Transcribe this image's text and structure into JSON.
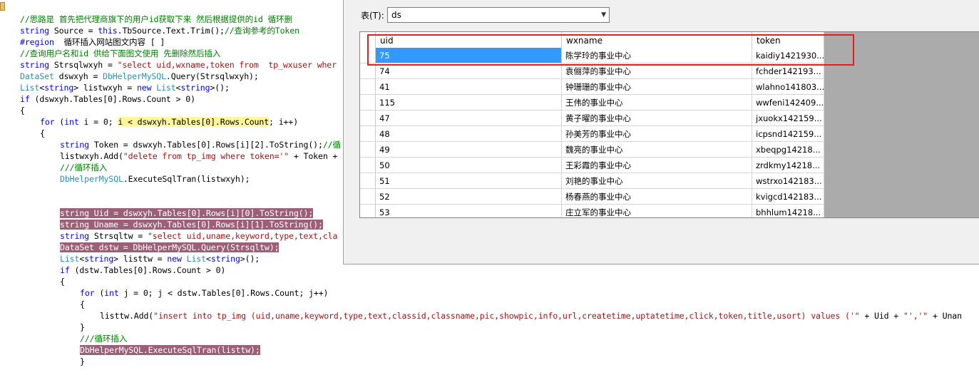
{
  "editor": {
    "lines": [
      {
        "indent": 2,
        "parts": [
          {
            "t": "//思路是 首先把代理商旗下的用户id获取下来 然后根据提供的id 循环删",
            "c": "cmt"
          }
        ]
      },
      {
        "indent": 2,
        "parts": [
          {
            "t": "string",
            "c": "kw"
          },
          {
            "t": " Source = "
          },
          {
            "t": "this",
            "c": "kw"
          },
          {
            "t": ".TbSource.Text.Trim();"
          },
          {
            "t": "//查询参考的Token",
            "c": "cmt"
          }
        ]
      },
      {
        "indent": 2,
        "parts": [
          {
            "t": "#region",
            "c": "kw"
          },
          {
            "t": "  循环插入网站图文内容 [ ]"
          }
        ]
      },
      {
        "indent": 2,
        "parts": [
          {
            "t": "//查询用户名和id 供给下面图文使用 先删除然后插入",
            "c": "cmt"
          }
        ]
      },
      {
        "indent": 2,
        "parts": [
          {
            "t": "string",
            "c": "kw"
          },
          {
            "t": " Strsqlwxyh = "
          },
          {
            "t": "\"select uid,wxname,token from  tp_wxuser wher",
            "c": "str"
          }
        ]
      },
      {
        "indent": 2,
        "parts": [
          {
            "t": "DataSet",
            "c": "ty"
          },
          {
            "t": " dswxyh = "
          },
          {
            "t": "DbHelperMySQL",
            "c": "ty"
          },
          {
            "t": ".Query(Strsqlwxyh);"
          }
        ]
      },
      {
        "indent": 2,
        "parts": [
          {
            "t": "List",
            "c": "ty"
          },
          {
            "t": "<"
          },
          {
            "t": "string",
            "c": "kw"
          },
          {
            "t": "> listwxyh = "
          },
          {
            "t": "new",
            "c": "kw"
          },
          {
            "t": " "
          },
          {
            "t": "List",
            "c": "ty"
          },
          {
            "t": "<"
          },
          {
            "t": "string",
            "c": "kw"
          },
          {
            "t": ">();"
          }
        ]
      },
      {
        "indent": 2,
        "parts": [
          {
            "t": "if",
            "c": "kw"
          },
          {
            "t": " (dswxyh.Tables[0].Rows.Count > 0)"
          }
        ]
      },
      {
        "indent": 2,
        "parts": [
          {
            "t": "{"
          }
        ]
      },
      {
        "indent": 3,
        "parts": [
          {
            "t": "for",
            "c": "kw"
          },
          {
            "t": " ("
          },
          {
            "t": "int",
            "c": "kw"
          },
          {
            "t": " i = 0; "
          },
          {
            "t": "i < dswxyh.Tables[0].Rows.Count",
            "h": "yellow"
          },
          {
            "t": "; i++)"
          }
        ]
      },
      {
        "indent": 3,
        "parts": [
          {
            "t": "{"
          }
        ]
      },
      {
        "indent": 4,
        "parts": [
          {
            "t": "string",
            "c": "kw"
          },
          {
            "t": " Token = dswxyh.Tables[0].Rows[i][2].ToString();"
          },
          {
            "t": "//循",
            "c": "cmt"
          }
        ]
      },
      {
        "indent": 4,
        "parts": [
          {
            "t": "listwxyh.Add("
          },
          {
            "t": "\"delete from tp_img where token='\"",
            "c": "str"
          },
          {
            "t": " + Token +"
          }
        ]
      },
      {
        "indent": 4,
        "parts": [
          {
            "t": "///循环插入",
            "c": "cmt"
          }
        ]
      },
      {
        "indent": 4,
        "parts": [
          {
            "t": "DbHelperMySQL",
            "c": "ty"
          },
          {
            "t": ".ExecuteSqlTran(listwxyh);"
          }
        ]
      },
      {
        "indent": 0,
        "parts": []
      },
      {
        "indent": 0,
        "parts": []
      },
      {
        "indent": 4,
        "parts": [
          {
            "t": "string Uid = dswxyh.Tables[0].Rows[i][0].ToString();",
            "h": "mauve"
          }
        ]
      },
      {
        "indent": 4,
        "parts": [
          {
            "t": "string Uname = dswxyh.Tables[0].Rows[i][1].ToString();",
            "h": "mauve"
          }
        ]
      },
      {
        "indent": 4,
        "parts": [
          {
            "t": "string",
            "c": "kw"
          },
          {
            "t": " Strsqltw = "
          },
          {
            "t": "\"select uid,uname,keyword,type,text,cla",
            "c": "str"
          }
        ]
      },
      {
        "indent": 4,
        "parts": [
          {
            "t": "DataSet dstw = DbHelperMySQL.Query(Strsqltw);",
            "h": "mauve"
          }
        ]
      },
      {
        "indent": 4,
        "parts": [
          {
            "t": "List",
            "c": "ty"
          },
          {
            "t": "<"
          },
          {
            "t": "string",
            "c": "kw"
          },
          {
            "t": "> listtw = "
          },
          {
            "t": "new",
            "c": "kw"
          },
          {
            "t": " "
          },
          {
            "t": "List",
            "c": "ty"
          },
          {
            "t": "<"
          },
          {
            "t": "string",
            "c": "kw"
          },
          {
            "t": ">();"
          }
        ]
      },
      {
        "indent": 4,
        "parts": [
          {
            "t": "if",
            "c": "kw"
          },
          {
            "t": " (dstw.Tables[0].Rows.Count > 0)"
          }
        ]
      },
      {
        "indent": 4,
        "parts": [
          {
            "t": "{"
          }
        ]
      },
      {
        "indent": 5,
        "parts": [
          {
            "t": "for",
            "c": "kw"
          },
          {
            "t": " ("
          },
          {
            "t": "int",
            "c": "kw"
          },
          {
            "t": " j = 0; j < dstw.Tables[0].Rows.Count; j++)"
          }
        ]
      },
      {
        "indent": 5,
        "parts": [
          {
            "t": "{"
          }
        ]
      },
      {
        "indent": 6,
        "parts": [
          {
            "t": "listtw.Add("
          },
          {
            "t": "\"insert into tp_img (uid,uname,keyword,type,text,classid,classname,pic,showpic,info,url,createtime,uptatetime,click,token,title,usort) values ('\"",
            "c": "str"
          },
          {
            "t": " + Uid + "
          },
          {
            "t": "\"','\"",
            "c": "str"
          },
          {
            "t": " + Unan"
          }
        ]
      },
      {
        "indent": 5,
        "parts": [
          {
            "t": "}"
          }
        ]
      },
      {
        "indent": 5,
        "parts": [
          {
            "t": "///循环插入",
            "c": "cmt"
          }
        ]
      },
      {
        "indent": 5,
        "parts": [
          {
            "t": "DbHelperMySQL.ExecuteSqlTran(listtw);",
            "h": "mauve"
          }
        ]
      },
      {
        "indent": 5,
        "parts": [
          {
            "t": "}"
          }
        ]
      }
    ]
  },
  "dialog": {
    "table_label": "表(T):",
    "table_select_value": "ds",
    "grid": {
      "columns": [
        "uid",
        "wxname",
        "token"
      ],
      "rows": [
        [
          "75",
          "陈学玲的事业中心",
          "kaidiy1421930..."
        ],
        [
          "74",
          "袁俪萍的事业中心",
          "fchder142193..."
        ],
        [
          "41",
          "钟珊珊的事业中心",
          "wlahno141803..."
        ],
        [
          "115",
          "王伟的事业中心",
          "wwfeni142409..."
        ],
        [
          "47",
          "黄子曜的事业中心",
          "jxuokx142159..."
        ],
        [
          "48",
          "孙美芳的事业中心",
          "icpsnd142159..."
        ],
        [
          "49",
          "魏亮的事业中心",
          "xbeqpg14218..."
        ],
        [
          "50",
          "王彩霞的事业中心",
          "zrdkmy14218..."
        ],
        [
          "51",
          "刘艳的事业中心",
          "wstrxo142183..."
        ],
        [
          "52",
          "杨春燕的事业中心",
          "kvigcd142183..."
        ],
        [
          "53",
          "庄立军的事业中心",
          "bhhlum14218..."
        ]
      ],
      "selected_row": 0
    }
  },
  "colors": {
    "keyword": "#0000ff",
    "type": "#2b91af",
    "string": "#a31515",
    "comment": "#008000",
    "highlight": "#9c5f78",
    "selection": "#3399ff",
    "annotation_box": "#e02020"
  }
}
